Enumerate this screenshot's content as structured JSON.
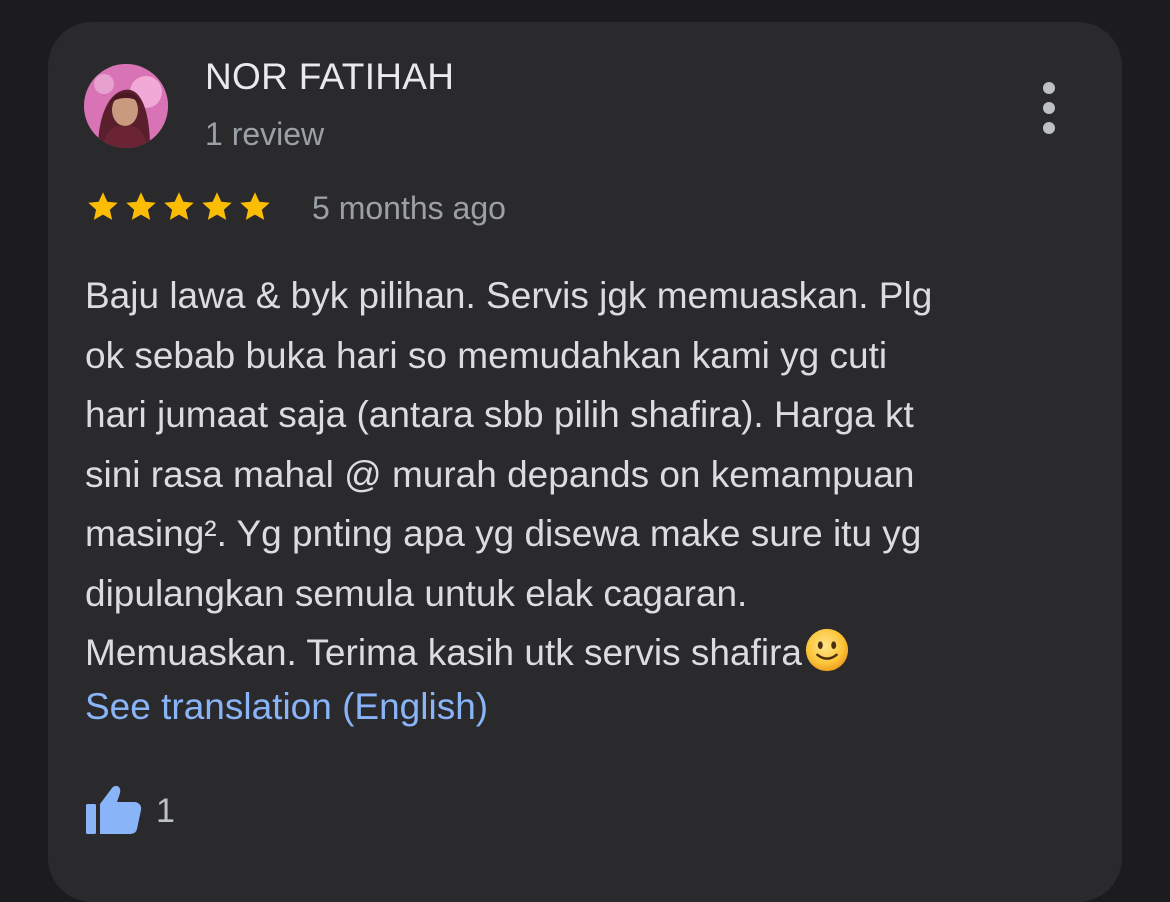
{
  "review": {
    "reviewer_name": "NOR FATIHAH",
    "review_count": "1 review",
    "rating": 5,
    "rating_max": 5,
    "time_ago": "5 months ago",
    "text_lines": [
      "Baju lawa & byk pilihan. Servis jgk memuaskan. Plg",
      "ok sebab buka hari so memudahkan kami yg cuti",
      "hari jumaat saja (antara sbb pilih shafira). Harga kt",
      "sini rasa mahal @ murah depands on kemampuan",
      "masing². Yg pnting apa yg disewa make sure itu yg",
      "dipulangkan semula untuk elak cagaran.",
      "Memuaskan. Terima kasih utk servis shafira"
    ],
    "emoji": "slightly-smiling-face",
    "see_translation": "See translation (English)",
    "like_count": "1"
  },
  "icons": {
    "more": "more-vertical-icon",
    "star": "star-icon",
    "like": "thumbs-up-icon"
  },
  "colors": {
    "background": "#1c1c1e",
    "card": "#2a2a2d",
    "star": "#fbbc04",
    "link": "#8ab4f8",
    "like_icon": "#8ab4f8"
  }
}
